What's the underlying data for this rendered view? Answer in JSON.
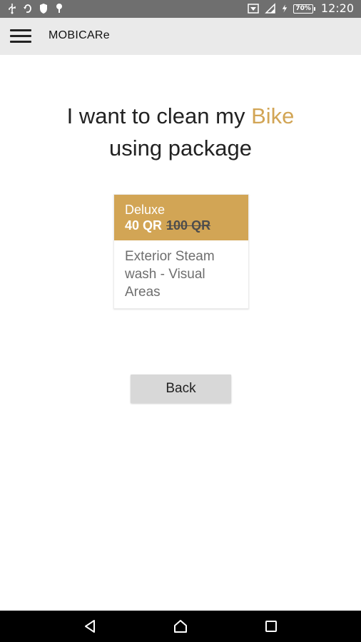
{
  "status_bar": {
    "time": "12:20",
    "battery": "70%",
    "left_icons": [
      "usb-icon",
      "sync-icon",
      "shield-icon",
      "location-icon"
    ],
    "right_icons": [
      "wifi-icon",
      "signal-icon",
      "charging-icon",
      "battery-icon"
    ]
  },
  "app_bar": {
    "title": "MOBICARe",
    "menu_icon": "hamburger-menu-icon"
  },
  "heading": {
    "prefix": "I want to clean my ",
    "vehicle": "Bike",
    "suffix": "using package",
    "accent_color": "#d2a555"
  },
  "package": {
    "name": "Deluxe",
    "price": "40 QR",
    "old_price": "100 QR",
    "description": "Exterior Steam wash - Visual Areas",
    "header_color": "#d2a555"
  },
  "back_button": {
    "label": "Back"
  },
  "nav_bar": {
    "buttons": [
      "back-nav-icon",
      "home-nav-icon",
      "recents-nav-icon"
    ]
  }
}
